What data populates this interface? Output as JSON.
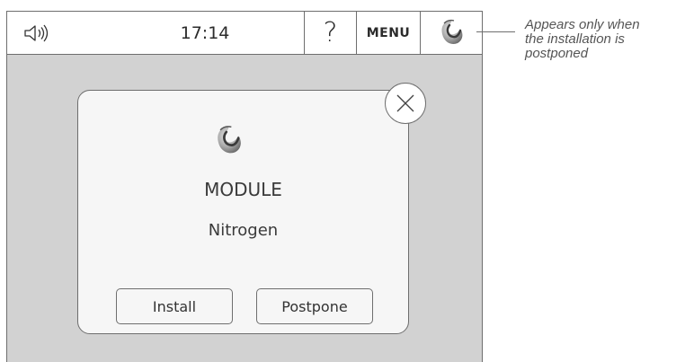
{
  "topbar": {
    "sound_icon": "speaker-icon",
    "time": "17:14",
    "help_label": "?",
    "menu_label": "MENU",
    "module_icon": "module-swirl-icon"
  },
  "dialog": {
    "icon": "module-swirl-icon",
    "title": "MODULE",
    "subtitle": "Nitrogen",
    "install_label": "Install",
    "postpone_label": "Postpone",
    "close_icon": "close-icon"
  },
  "annotation": {
    "lines": [
      "Appears only when",
      "the installation is",
      "postponed"
    ]
  },
  "colors": {
    "screen_background": "#d2d2d2",
    "dialog_background": "#f6f6f6",
    "border": "#6e6e6e"
  }
}
